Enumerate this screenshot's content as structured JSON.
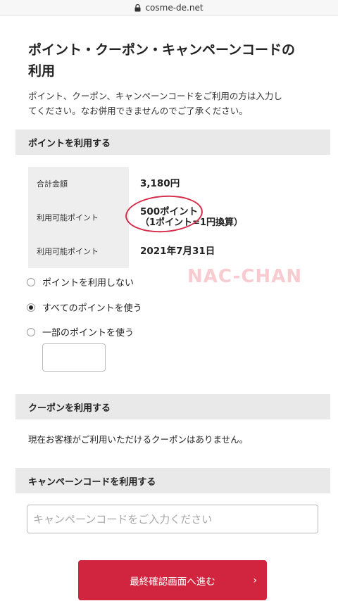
{
  "browser": {
    "url": "cosme-de.net"
  },
  "page": {
    "title_line1": "ポイント・クーポン・キャンペーンコードの",
    "title_line2": "利用",
    "intro_line1": "ポイント、クーポン、キャンペーンコードをご利用の方は入力し",
    "intro_line2": "てください。なお併用できませんのでご了承ください。"
  },
  "points": {
    "section_title": "ポイントを利用する",
    "rows": [
      {
        "label": "合計金額",
        "value": "3,180円",
        "sub": ""
      },
      {
        "label": "利用可能ポイント",
        "value": "500ポイント",
        "sub": "（1ポイント=1円換算）"
      },
      {
        "label": "利用可能ポイント",
        "value": "2021年7月31日",
        "sub": ""
      }
    ],
    "options": [
      {
        "label": "ポイントを利用しない",
        "checked": false
      },
      {
        "label": "すべてのポイントを使う",
        "checked": true
      },
      {
        "label": "一部のポイントを使う",
        "checked": false
      }
    ],
    "partial_input_value": ""
  },
  "watermark": "NAC-CHAN",
  "coupon": {
    "section_title": "クーポンを利用する",
    "message": "現在お客様がご利用いただけるクーポンはありません。"
  },
  "campaign": {
    "section_title": "キャンペーンコードを利用する",
    "placeholder": "キャンペーンコードをご入力ください",
    "value": ""
  },
  "submit": {
    "label": "最終確認画面へ進む",
    "icon": "chevron-right-icon"
  },
  "colors": {
    "accent": "#d0243f",
    "annotation": "#d62c4a",
    "section_bg": "#e9e9e9"
  }
}
